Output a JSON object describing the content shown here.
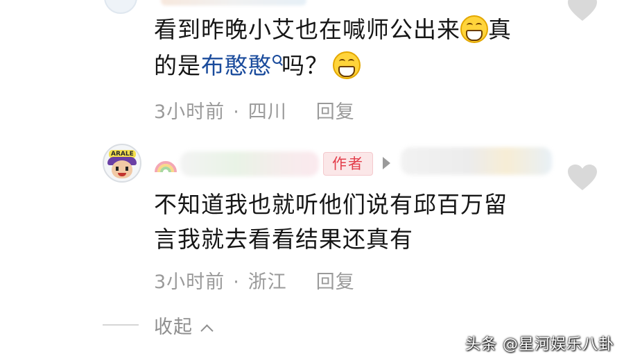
{
  "comment1": {
    "text_part1": "看到昨晚小艾也在喊师公出来",
    "emoji1": "grin-emoji",
    "text_part2": "真",
    "text_part3": "的是",
    "mention": "布憨憨",
    "text_part4": "吗？",
    "emoji2": "grin-emoji",
    "time": "3小时前",
    "separator": "·",
    "location": "四川",
    "reply_label": "回复"
  },
  "comment2": {
    "author_badge": "作者",
    "line1": "不知道我也就听他们说有邱百万留",
    "line2": "言我就去看看结果还真有",
    "time": "3小时前",
    "separator": "·",
    "location": "浙江",
    "reply_label": "回复",
    "avatar_text": "ARALE"
  },
  "collapse": {
    "label": "收起"
  },
  "watermark": "头条 @星河娱乐八卦",
  "colors": {
    "mention": "#1a4b9c",
    "author_badge_text": "#e33c4a",
    "author_badge_bg": "#fbe7e8",
    "meta_text": "#9a9a9a",
    "heart": "#d9d9d9"
  }
}
